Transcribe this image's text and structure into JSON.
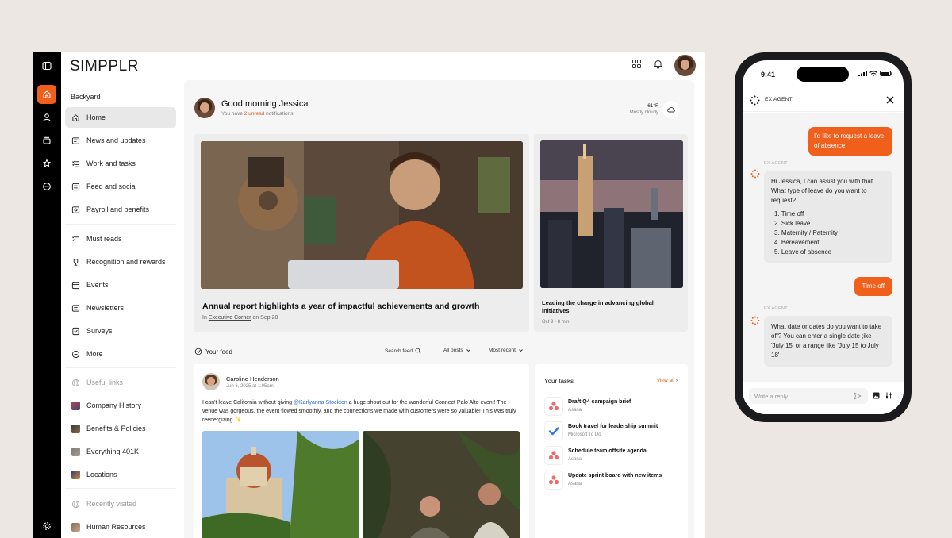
{
  "app": {
    "logo": "SIMPPLR",
    "accent": "#f05f1c"
  },
  "sidebar": {
    "title": "Backyard",
    "items": [
      {
        "label": "Home",
        "icon": "home-icon"
      },
      {
        "label": "News and updates",
        "icon": "news-icon"
      },
      {
        "label": "Work and tasks",
        "icon": "checklist-icon"
      },
      {
        "label": "Feed and social",
        "icon": "feed-icon"
      },
      {
        "label": "Payroll and benefits",
        "icon": "payroll-icon"
      },
      {
        "label": "Must reads",
        "icon": "checklist-icon"
      },
      {
        "label": "Recognition and rewards",
        "icon": "trophy-icon"
      },
      {
        "label": "Events",
        "icon": "calendar-icon"
      },
      {
        "label": "Newsletters",
        "icon": "newsletter-icon"
      },
      {
        "label": "Surveys",
        "icon": "survey-icon"
      },
      {
        "label": "More",
        "icon": "more-icon"
      }
    ],
    "useful_links_label": "Useful links",
    "links": [
      "Company History",
      "Benefits & Policies",
      "Everything 401K",
      "Locations"
    ],
    "recently_visited_label": "Recently visited",
    "recent": [
      "Human Resources"
    ]
  },
  "greeting": {
    "title": "Good morning Jessica",
    "sub_prefix": "You have ",
    "unread": "2 unread",
    "sub_suffix": " notifications"
  },
  "weather": {
    "temp": "61°F",
    "desc": "Mostly cloudy"
  },
  "featured": {
    "title": "Annual report highlights a year of impactful achievements and growth",
    "meta_prefix": "In ",
    "meta_link": "Executive Corner",
    "meta_suffix": " on Sep 28"
  },
  "side_story": {
    "title": "Leading the charge in advancing global initiatives",
    "meta": "Oct 9  •  8 min"
  },
  "feed": {
    "label": "Your feed",
    "search": "Search feed",
    "filter": "All posts",
    "sort": "Most recent",
    "post": {
      "author": "Caroline Henderson",
      "date": "Jun 6, 2025 at 1:05am",
      "text_before": "I can't leave California without giving ",
      "mention": "@Karlyanna Stockton",
      "text_after": " a huge shout out for the wonderful Connect Palo Alto event! The venue was gorgeous, the event flowed smoothly, and the connections we made with customers were so valuable! This was truly reenergizing ✨"
    }
  },
  "tasks": {
    "title": "Your tasks",
    "view_all": "View all",
    "items": [
      {
        "title": "Draft Q4 campaign brief",
        "source": "Asana"
      },
      {
        "title": "Book travel for leadership summit",
        "source": "Microsoft To Do"
      },
      {
        "title": "Schedule team offsite agenda",
        "source": "Asana"
      },
      {
        "title": "Update sprint board with new items",
        "source": "Asana"
      }
    ]
  },
  "phone": {
    "time": "9:41",
    "agent_name": "EX AGENT",
    "agent_tag": "EX AGENT",
    "messages": {
      "user1": "I'd like to request a leave of absence",
      "bot1": "Hi Jessica, I can assist you with that. What type of leave do you want to request?",
      "options": [
        "Time off",
        "Sick leave",
        "Maternity / Paternity",
        "Bereavement",
        "Leave of absence"
      ],
      "user2": "Time off",
      "bot2": "What date or dates do you want to take off? You can enter a single date ;ike 'July 15' or a range like 'July 15 to July 18'"
    },
    "reply_placeholder": "Write a reply..."
  }
}
